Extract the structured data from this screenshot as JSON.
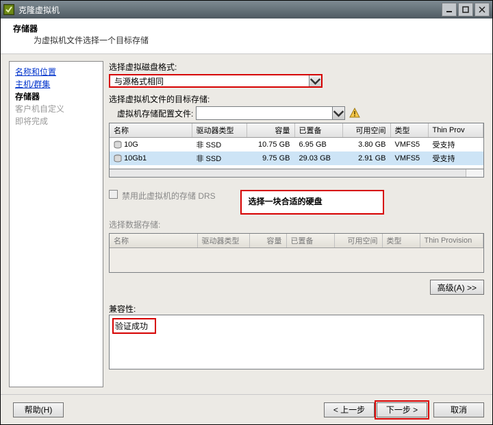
{
  "window": {
    "title": "克隆虚拟机"
  },
  "header": {
    "title": "存储器",
    "subtitle": "为虚拟机文件选择一个目标存储"
  },
  "sidebar": {
    "items": [
      {
        "label": "名称和位置",
        "kind": "link"
      },
      {
        "label": "主机/群集",
        "kind": "link"
      },
      {
        "label": "存储器",
        "kind": "current"
      },
      {
        "label": "客户机自定义",
        "kind": "disabled"
      },
      {
        "label": "即将完成",
        "kind": "disabled"
      }
    ]
  },
  "content": {
    "format_label": "选择虚拟磁盘格式:",
    "format_value": "与源格式相同",
    "target_label": "选择虚拟机文件的目标存储:",
    "profile_label": "虚拟机存储配置文件:",
    "profile_value": "",
    "table1": {
      "headers": [
        "名称",
        "驱动器类型",
        "容量",
        "已置备",
        "可用空间",
        "类型",
        "Thin Prov"
      ],
      "rows": [
        {
          "name": "10G",
          "drive": "非 SSD",
          "cap": "10.75 GB",
          "prov": "6.95 GB",
          "free": "3.80 GB",
          "type": "VMFS5",
          "thin": "受支持",
          "sel": false
        },
        {
          "name": "10Gb1",
          "drive": "非 SSD",
          "cap": "9.75 GB",
          "prov": "29.03 GB",
          "free": "2.91 GB",
          "type": "VMFS5",
          "thin": "受支持",
          "sel": true
        }
      ]
    },
    "drs_label": "禁用此虚拟机的存储 DRS",
    "annotation": "选择一块合适的硬盘",
    "ds_label": "选择数据存储:",
    "table2": {
      "headers": [
        "名称",
        "驱动器类型",
        "容量",
        "已置备",
        "可用空间",
        "类型",
        "Thin Provision"
      ]
    },
    "advanced_btn": "高级(A) >>",
    "compat_label": "兼容性:",
    "compat_value": "验证成功"
  },
  "footer": {
    "help": "帮助(H)",
    "back": "< 上一步",
    "next": "下一步 >",
    "cancel": "取消"
  }
}
